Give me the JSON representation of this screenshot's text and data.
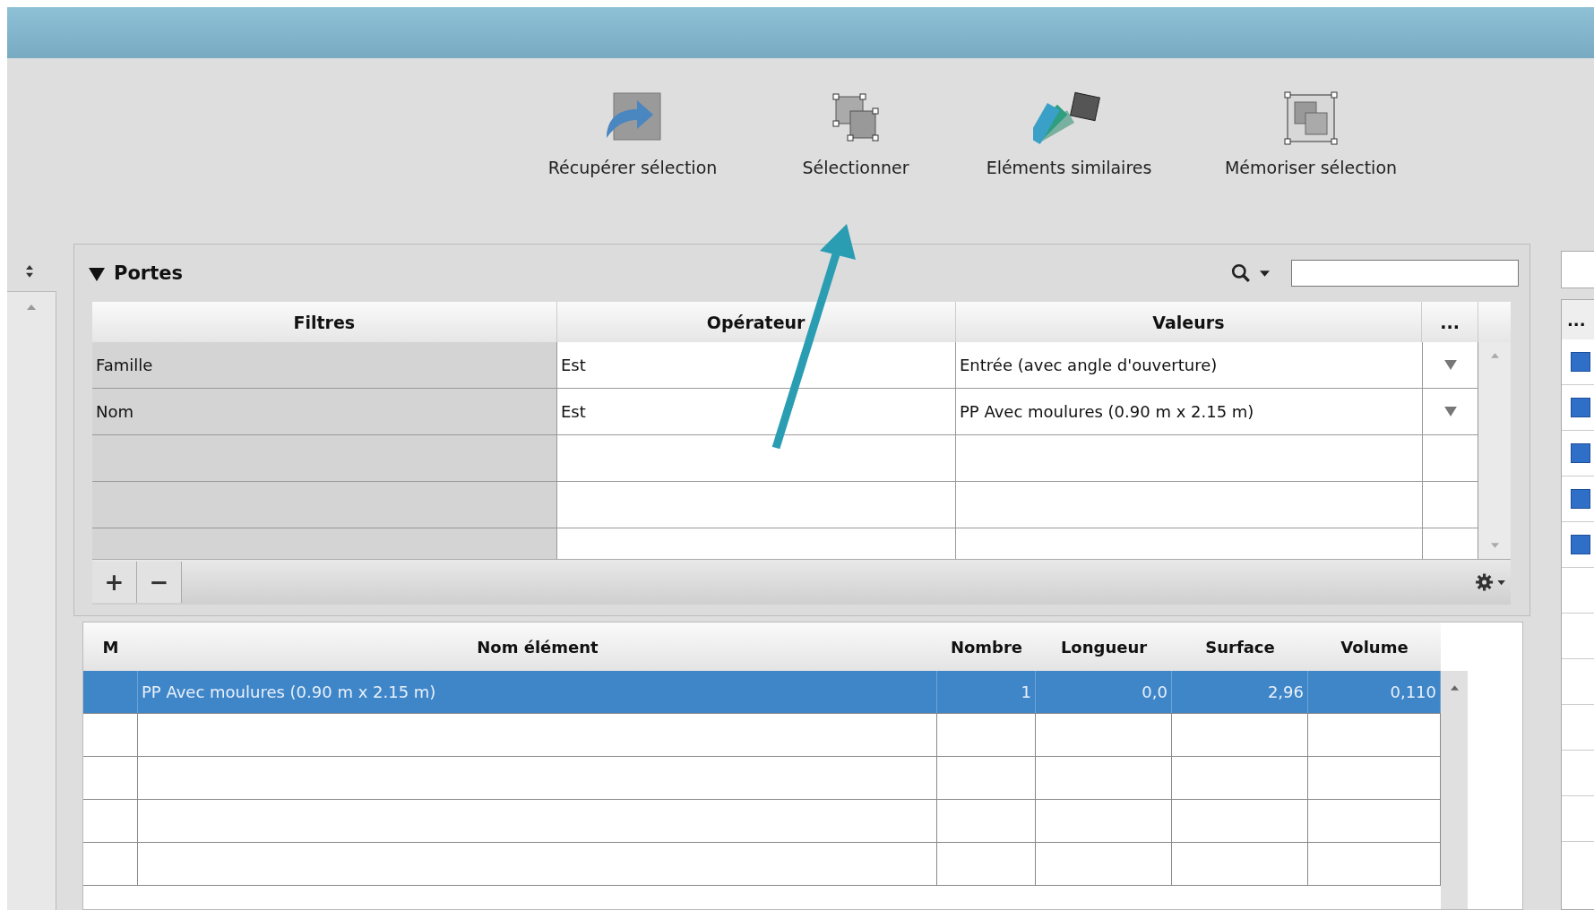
{
  "toolbar": {
    "buttons": [
      {
        "label": "Récupérer sélection",
        "kind": "retrieve"
      },
      {
        "label": "Sélectionner",
        "kind": "select"
      },
      {
        "label": "Eléments similaires",
        "kind": "similar"
      },
      {
        "label": "Mémoriser sélection",
        "kind": "memorize"
      }
    ]
  },
  "panel": {
    "title": "Portes",
    "expanded": true
  },
  "filters": {
    "columns": [
      "Filtres",
      "Opérateur",
      "Valeurs",
      "..."
    ],
    "rows": [
      {
        "filter": "Famille",
        "operator": "Est",
        "value": "Entrée (avec angle d'ouverture)"
      },
      {
        "filter": "Nom",
        "operator": "Est",
        "value": "PP Avec moulures (0.90 m x 2.15 m)"
      }
    ],
    "add_button": "+",
    "remove_button": "−"
  },
  "results": {
    "columns": [
      "M",
      "Nom élément",
      "Nombre",
      "Longueur",
      "Surface",
      "Volume"
    ],
    "rows": [
      {
        "selected": true,
        "cells": [
          "",
          "PP Avec moulures (0.90 m x 2.15 m)",
          "1",
          "0,0",
          "2,96",
          "0,110"
        ]
      }
    ]
  },
  "side_list": {
    "header": "...",
    "rows": [
      {
        "marked": true
      },
      {
        "marked": true
      },
      {
        "marked": true
      },
      {
        "marked": true
      },
      {
        "marked": true
      },
      {
        "marked": false
      },
      {
        "marked": false
      },
      {
        "marked": false
      },
      {
        "marked": false
      },
      {
        "marked": false
      },
      {
        "marked": false
      }
    ]
  }
}
